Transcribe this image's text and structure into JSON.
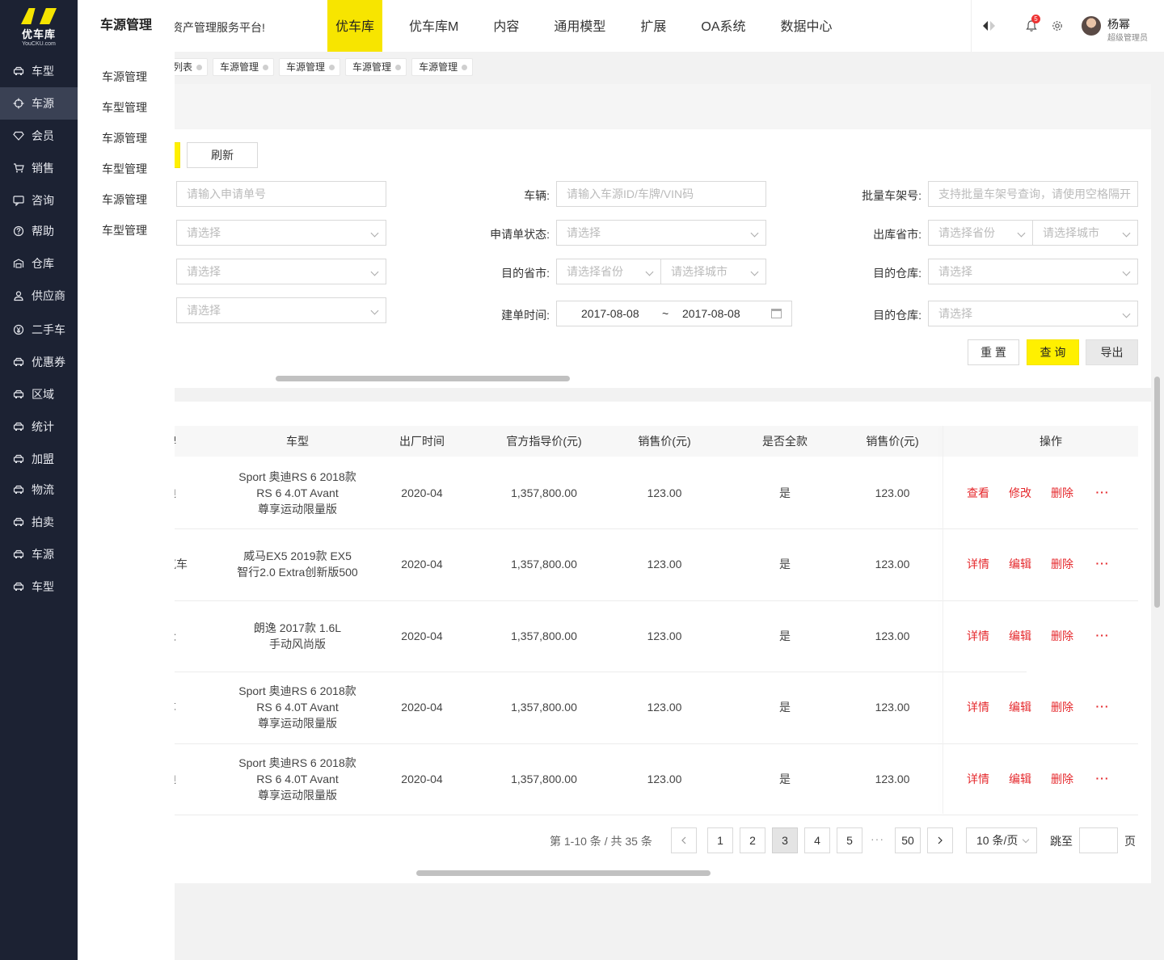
{
  "brand": {
    "name": "优车库",
    "sub": "YouCKU.com",
    "accent": "#f7e500"
  },
  "sidebar": {
    "items": [
      {
        "label": "车型",
        "icon": "car-icon"
      },
      {
        "label": "车源",
        "icon": "crosshair-icon",
        "active": true
      },
      {
        "label": "会员",
        "icon": "diamond-icon"
      },
      {
        "label": "销售",
        "icon": "cart-icon"
      },
      {
        "label": "咨询",
        "icon": "chat-icon"
      },
      {
        "label": "帮助",
        "icon": "help-icon"
      },
      {
        "label": "仓库",
        "icon": "warehouse-icon"
      },
      {
        "label": "供应商",
        "icon": "person-icon"
      },
      {
        "label": "二手车",
        "icon": "yen-icon"
      },
      {
        "label": "优惠券",
        "icon": "car-icon"
      },
      {
        "label": "区域",
        "icon": "car-icon"
      },
      {
        "label": "统计",
        "icon": "car-icon"
      },
      {
        "label": "加盟",
        "icon": "car-icon"
      },
      {
        "label": "物流",
        "icon": "car-icon"
      },
      {
        "label": "拍卖",
        "icon": "car-icon"
      },
      {
        "label": "车源",
        "icon": "car-icon"
      },
      {
        "label": "车型",
        "icon": "car-icon"
      }
    ]
  },
  "submenu": {
    "title": "车源管理",
    "items": [
      "车源管理",
      "车型管理",
      "车源管理",
      "车型管理",
      "车源管理",
      "车型管理"
    ]
  },
  "header": {
    "welcome": "资产管理服务平台!",
    "nav": [
      {
        "label": "优车库",
        "active": true
      },
      {
        "label": "优车库M"
      },
      {
        "label": "内容"
      },
      {
        "label": "通用模型"
      },
      {
        "label": "扩展"
      },
      {
        "label": "OA系统"
      },
      {
        "label": "数据中心"
      }
    ],
    "notify_count": "5",
    "user_name": "杨幂",
    "user_role": "超级管理员"
  },
  "tabs": [
    "车型列表",
    "车源管理",
    "车源管理",
    "车源管理",
    "车源管理"
  ],
  "filters": {
    "refresh": "刷新",
    "apply_no_placeholder": "请输入申请单号",
    "select_placeholder": "请选择",
    "vehicle_label": "车辆:",
    "vehicle_placeholder": "请输入车源ID/车牌/VIN码",
    "batch_label": "批量车架号:",
    "batch_placeholder": "支持批量车架号查询，请使用空格隔开",
    "status_label": "申请单状态:",
    "out_city_label": "出库省市:",
    "province_placeholder": "请选择省份",
    "city_placeholder": "请选择城市",
    "dest_city_label": "目的省市:",
    "dest_wh_label": "目的仓库:",
    "date_label": "建单时间:",
    "date_from": "2017-08-08",
    "date_sep": "~",
    "date_to": "2017-08-08",
    "dest_wh2_label": "目的仓库:",
    "reset": "重 置",
    "query": "查 询",
    "export": "导出"
  },
  "table": {
    "columns": [
      "品牌",
      "车型",
      "出厂时间",
      "官方指导价(元)",
      "销售价(元)",
      "是否全款",
      "销售价(元)",
      "操作"
    ],
    "rows": [
      {
        "brand": "奥迪",
        "model": [
          "Sport 奥迪RS 6 2018款",
          "RS 6 4.0T Avant",
          "尊享运动限量版"
        ],
        "date": "2020-04",
        "guide": "1,357,800.00",
        "price": "123.00",
        "full": "是",
        "price2": "123.00",
        "actions": [
          "查看",
          "修改",
          "删除"
        ]
      },
      {
        "brand": "长城汽车",
        "model": [
          "威马EX5 2019款 EX5",
          "智行2.0 Extra创新版500"
        ],
        "date": "2020-04",
        "guide": "1,357,800.00",
        "price": "123.00",
        "full": "是",
        "price2": "123.00",
        "actions": [
          "详情",
          "编辑",
          "删除"
        ]
      },
      {
        "brand": "大众",
        "model": [
          "朗逸 2017款 1.6L",
          "手动风尚版"
        ],
        "date": "2020-04",
        "guide": "1,357,800.00",
        "price": "123.00",
        "full": "是",
        "price2": "123.00",
        "actions": [
          "详情",
          "编辑",
          "删除"
        ]
      },
      {
        "brand": "客车",
        "model": [
          "Sport 奥迪RS 6 2018款",
          "RS 6 4.0T Avant",
          "尊享运动限量版"
        ],
        "date": "2020-04",
        "guide": "1,357,800.00",
        "price": "123.00",
        "full": "是",
        "price2": "123.00",
        "actions": [
          "详情",
          "编辑",
          "删除"
        ]
      },
      {
        "brand": "奥迪",
        "model": [
          "Sport 奥迪RS 6 2018款",
          "RS 6 4.0T Avant",
          "尊享运动限量版"
        ],
        "date": "2020-04",
        "guide": "1,357,800.00",
        "price": "123.00",
        "full": "是",
        "price2": "123.00",
        "actions": [
          "详情",
          "编辑",
          "删除"
        ]
      }
    ],
    "more": "···"
  },
  "pagination": {
    "total": "第 1-10 条 / 共 35 条",
    "pages": [
      "1",
      "2",
      "3",
      "4",
      "5"
    ],
    "active": "3",
    "ellipsis": "···",
    "last": "50",
    "page_size": "10 条/页",
    "jump_label": "跳至",
    "page_label": "页"
  }
}
